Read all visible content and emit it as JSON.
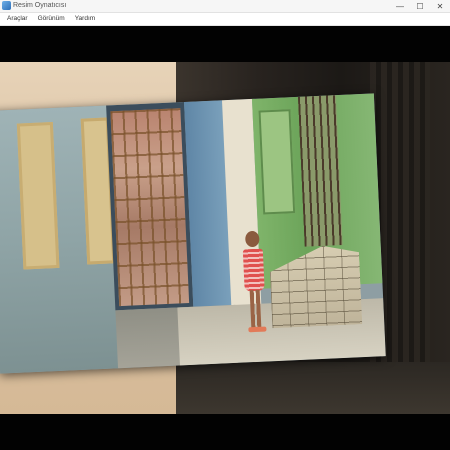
{
  "window": {
    "title": "Resim Oynatıcısı",
    "controls": {
      "minimize_glyph": "—",
      "maximize_glyph": "☐",
      "close_glyph": "✕"
    }
  },
  "menu": {
    "items": [
      {
        "label": "Araçlar"
      },
      {
        "label": "Görünüm"
      },
      {
        "label": "Yardım"
      }
    ]
  },
  "viewer": {
    "background_color": "#020202",
    "slide_description_icons": [
      "photo-slide"
    ]
  }
}
